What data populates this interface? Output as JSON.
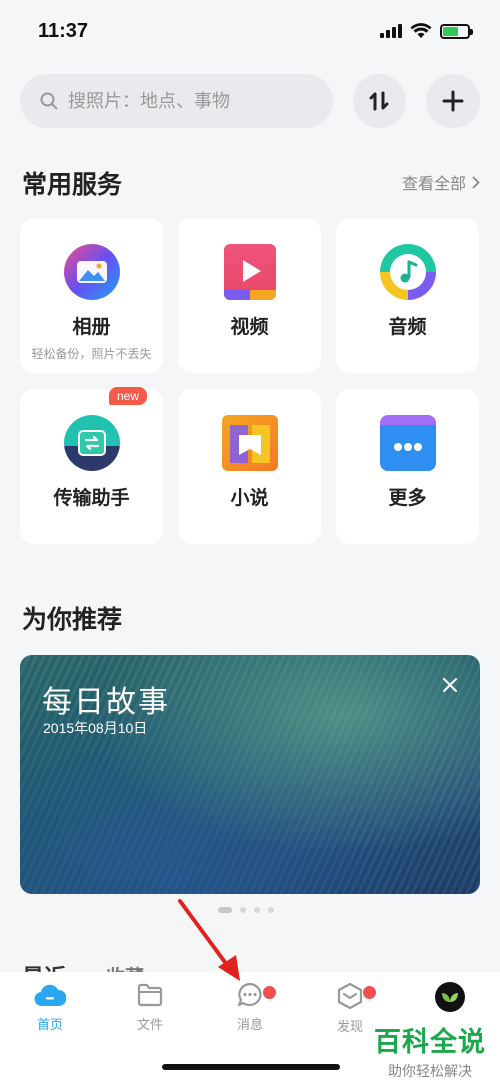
{
  "status_bar": {
    "time": "11:37"
  },
  "search": {
    "placeholder": "搜照片：地点、事物"
  },
  "services": {
    "title": "常用服务",
    "view_all": "查看全部",
    "items": [
      {
        "label": "相册",
        "sub": "轻松备份，照片不丢失",
        "icon": "album-icon"
      },
      {
        "label": "视频",
        "icon": "video-icon"
      },
      {
        "label": "音频",
        "icon": "audio-icon"
      },
      {
        "label": "传输助手",
        "badge": "new",
        "icon": "transfer-icon"
      },
      {
        "label": "小说",
        "icon": "novel-icon"
      },
      {
        "label": "更多",
        "icon": "more-icon"
      }
    ]
  },
  "recommend": {
    "title": "为你推荐",
    "banner": {
      "title": "每日故事",
      "date": "2015年08月10日"
    },
    "page_index": 1,
    "page_count": 4
  },
  "recent": {
    "tabs": [
      "最近",
      "收藏"
    ]
  },
  "tabbar": {
    "items": [
      {
        "label": "首页",
        "active": true
      },
      {
        "label": "文件"
      },
      {
        "label": "消息",
        "dot": true
      },
      {
        "label": "发现",
        "dot": true
      },
      {
        "label": ""
      }
    ]
  },
  "watermark": {
    "title": "百科全说",
    "sub": "助你轻松解决"
  },
  "colors": {
    "accent": "#2aa7f0",
    "badge": "#f25a4a",
    "watermark": "#1aa84a"
  }
}
